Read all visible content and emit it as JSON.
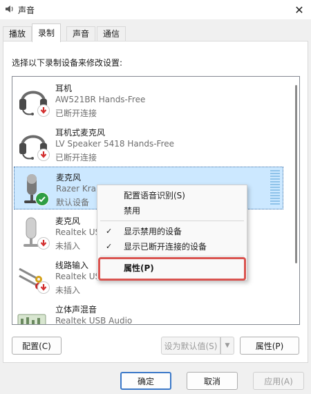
{
  "window": {
    "title": "声音",
    "close_label": "✕"
  },
  "tabs": [
    {
      "label": "播放"
    },
    {
      "label": "录制"
    },
    {
      "label": "声音"
    },
    {
      "label": "通信"
    }
  ],
  "instruction": "选择以下录制设备来修改设置:",
  "devices": [
    {
      "name": "耳机",
      "sub": "AW521BR Hands-Free",
      "status": "已断开连接",
      "icon": "headset-icon",
      "badge": "disconnected"
    },
    {
      "name": "耳机式麦克风",
      "sub": "LV Speaker 5418 Hands-Free",
      "status": "已断开连接",
      "icon": "headset-icon",
      "badge": "disconnected"
    },
    {
      "name": "麦克风",
      "sub": "Razer Kra",
      "status": "默认设备",
      "icon": "microphone-icon",
      "badge": "default"
    },
    {
      "name": "麦克风",
      "sub": "Realtek US",
      "status": "未插入",
      "icon": "microphone-icon",
      "badge": "unplugged"
    },
    {
      "name": "线路输入",
      "sub": "Realtek US",
      "status": "未插入",
      "icon": "line-in-icon",
      "badge": "unplugged"
    },
    {
      "name": "立体声混音",
      "sub": "Realtek USB Audio",
      "status": "",
      "icon": "stereo-mix-icon",
      "badge": "none"
    }
  ],
  "context_menu": {
    "items": [
      {
        "label": "配置语音识别(S)",
        "checked": false
      },
      {
        "label": "禁用",
        "checked": false
      },
      {
        "label": "显示禁用的设备",
        "checked": true
      },
      {
        "label": "显示已断开连接的设备",
        "checked": true
      },
      {
        "label": "属性(P)",
        "checked": false
      }
    ],
    "check_glyph": "✓"
  },
  "panel_buttons": {
    "configure": "配置(C)",
    "set_default": "设为默认值(S)",
    "properties": "属性(P)"
  },
  "dialog_buttons": {
    "ok": "确定",
    "cancel": "取消",
    "apply": "应用(A)"
  },
  "colors": {
    "selection": "#cce8ff",
    "highlight": "#d9534f",
    "ok_badge": "#2f9e44",
    "down_arrow": "#d32f2f"
  }
}
